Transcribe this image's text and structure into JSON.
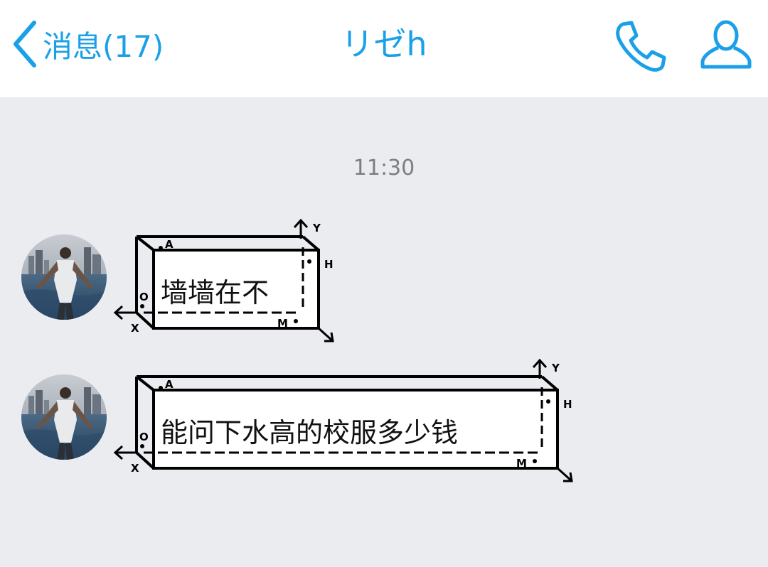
{
  "header": {
    "back_label": "消息(17)",
    "title": "リゼh",
    "icons": {
      "back": "chevron-left-icon",
      "phone": "phone-icon",
      "profile": "person-icon"
    },
    "accent_color": "#1aa0e8"
  },
  "chat": {
    "timestamp": "11:30",
    "messages": [
      {
        "text": "墙墙在不",
        "box_labels": {
          "a": "A",
          "y": "Y",
          "h": "H",
          "o": "O",
          "x": "X",
          "m": "M"
        }
      },
      {
        "text": "能问下水高的校服多少钱",
        "box_labels": {
          "a": "A",
          "y": "Y",
          "h": "H",
          "o": "O",
          "x": "X",
          "m": "M"
        }
      }
    ]
  },
  "colors": {
    "background": "#ebecf0",
    "header_background": "#ffffff",
    "timestamp": "#7d7e82"
  }
}
